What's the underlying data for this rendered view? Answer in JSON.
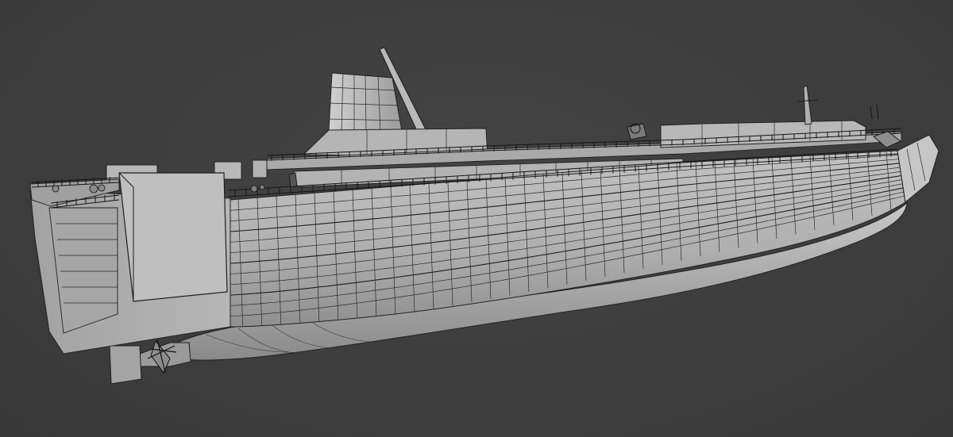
{
  "viewport": {
    "background": "#3d3d3d",
    "shading_mode": "solid",
    "overlay": "wireframe"
  },
  "model": {
    "object": "ship-hull",
    "hull_color": "#b4b4b4",
    "deck_color": "#9e9e9e",
    "wire_color": "#2a2a2a"
  }
}
